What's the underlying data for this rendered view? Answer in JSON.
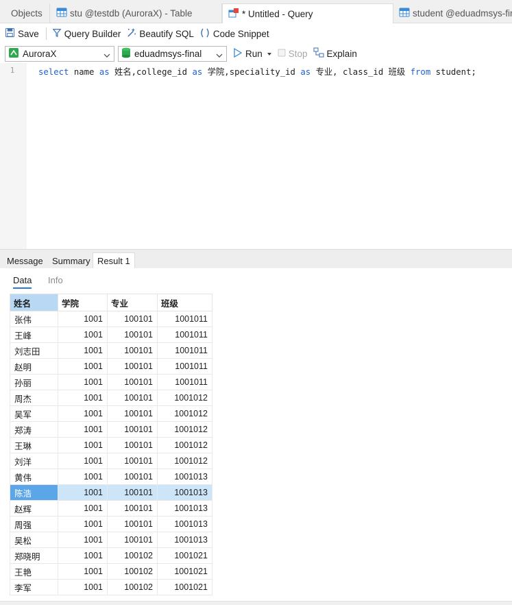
{
  "tabs": [
    {
      "label": "Objects"
    },
    {
      "label": "stu @testdb (AuroraX) - Table"
    },
    {
      "label": "* Untitled - Query"
    },
    {
      "label": "student @eduadmsys-final"
    }
  ],
  "toolbar": {
    "save": "Save",
    "query_builder": "Query Builder",
    "beautify": "Beautify SQL",
    "snippet": "Code Snippet"
  },
  "connection": {
    "server": "AuroraX",
    "database": "eduadmsys-final",
    "run": "Run",
    "stop": "Stop",
    "explain": "Explain"
  },
  "editor": {
    "line_number": "1",
    "tokens": [
      {
        "t": "select",
        "kw": true
      },
      {
        "t": " name ",
        "kw": false
      },
      {
        "t": "as",
        "kw": true
      },
      {
        "t": " 姓名,college_id ",
        "kw": false
      },
      {
        "t": "as",
        "kw": true
      },
      {
        "t": " 学院,speciality_id ",
        "kw": false
      },
      {
        "t": "as",
        "kw": true
      },
      {
        "t": " 专业, class_id 班级 ",
        "kw": false
      },
      {
        "t": "from",
        "kw": true
      },
      {
        "t": " student;",
        "kw": false
      }
    ]
  },
  "result_tabs": [
    "Message",
    "Summary",
    "Result 1"
  ],
  "sub_tabs": [
    "Data",
    "Info"
  ],
  "grid": {
    "columns": [
      "姓名",
      "学院",
      "专业",
      "班级"
    ],
    "selected_row": 11,
    "rows": [
      [
        "张伟",
        "1001",
        "100101",
        "1001011"
      ],
      [
        "王峰",
        "1001",
        "100101",
        "1001011"
      ],
      [
        "刘志田",
        "1001",
        "100101",
        "1001011"
      ],
      [
        "赵明",
        "1001",
        "100101",
        "1001011"
      ],
      [
        "孙丽",
        "1001",
        "100101",
        "1001011"
      ],
      [
        "周杰",
        "1001",
        "100101",
        "1001012"
      ],
      [
        "吴军",
        "1001",
        "100101",
        "1001012"
      ],
      [
        "郑涛",
        "1001",
        "100101",
        "1001012"
      ],
      [
        "王琳",
        "1001",
        "100101",
        "1001012"
      ],
      [
        "刘洋",
        "1001",
        "100101",
        "1001012"
      ],
      [
        "黄伟",
        "1001",
        "100101",
        "1001013"
      ],
      [
        "陈浩",
        "1001",
        "100101",
        "1001013"
      ],
      [
        "赵辉",
        "1001",
        "100101",
        "1001013"
      ],
      [
        "周强",
        "1001",
        "100101",
        "1001013"
      ],
      [
        "吴松",
        "1001",
        "100101",
        "1001013"
      ],
      [
        "郑晓明",
        "1001",
        "100102",
        "1001021"
      ],
      [
        "王艳",
        "1001",
        "100102",
        "1001021"
      ],
      [
        "李军",
        "1001",
        "100102",
        "1001021"
      ]
    ]
  },
  "colors": {
    "keyword": "#1f5fd1",
    "selection": "#5aa6e8",
    "selected_row": "#cde5f9",
    "header_selected": "#b8d8f4"
  }
}
